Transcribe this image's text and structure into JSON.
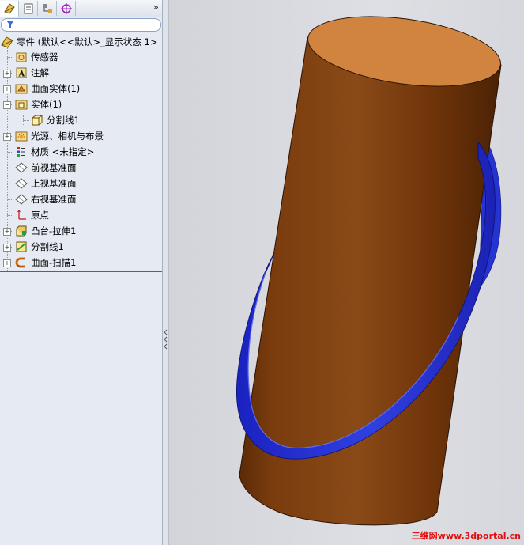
{
  "panel": {
    "tabs": [
      "feature-manager",
      "property-manager",
      "configuration-manager",
      "dim-xpert-manager"
    ],
    "more_label": "»"
  },
  "tree": {
    "root": "零件 (默认<<默认>_显示状态 1>",
    "items": [
      {
        "label": "传感器",
        "icon": "sensor-icon"
      },
      {
        "label": "注解",
        "icon": "annotation-icon"
      },
      {
        "label": "曲面实体(1)",
        "icon": "surface-bodies-icon"
      },
      {
        "label": "实体(1)",
        "icon": "solid-bodies-icon"
      },
      {
        "label": "分割线1",
        "icon": "body-icon"
      },
      {
        "label": "光源、相机与布景",
        "icon": "lights-cameras-icon"
      },
      {
        "label": "材质 <未指定>",
        "icon": "material-icon"
      },
      {
        "label": "前视基准面",
        "icon": "plane-icon"
      },
      {
        "label": "上视基准面",
        "icon": "plane-icon"
      },
      {
        "label": "右视基准面",
        "icon": "plane-icon"
      },
      {
        "label": "原点",
        "icon": "origin-icon"
      },
      {
        "label": "凸台-拉伸1",
        "icon": "extrude-icon"
      },
      {
        "label": "分割线1",
        "icon": "split-line-icon"
      },
      {
        "label": "曲面-扫描1",
        "icon": "sweep-surface-icon"
      }
    ]
  },
  "watermark": "三维网www.3dportal.cn",
  "colors": {
    "cylinder": "#7a3a0c",
    "cylinder_top": "#d0843f",
    "sweep": "#2a35d8",
    "selection": "#2b68c4"
  }
}
